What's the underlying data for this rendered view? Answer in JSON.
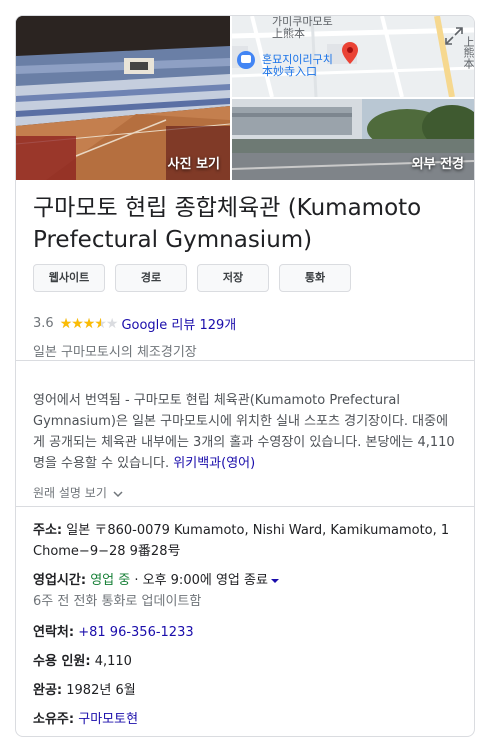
{
  "place": {
    "title": "구마모토 현립 종합체육관 (Kumamoto Prefectural Gymnasium)",
    "category": "일본 구마모토시의 체조경기장",
    "rating": {
      "score": "3.6",
      "fraction": 0.72,
      "reviews_link": "Google 리뷰 129개"
    }
  },
  "photos": {
    "interior_caption": "사진 보기",
    "street_caption": "외부 전경",
    "map_labels": {
      "station_ko": "가미쿠마모토",
      "station_ja": "上熊本",
      "temple_ko": "혼묘지이리구치",
      "temple_ja": "本妙寺入口",
      "side_label": "上熊本"
    }
  },
  "actions": [
    "웹사이트",
    "경로",
    "저장",
    "통화"
  ],
  "description": {
    "text": "영어에서 번역됨 - 구마모토 현립 체육관(Kumamoto Prefectural Gymnasium)은 일본 구마모토시에 위치한 실내 스포츠 경기장이다. 대중에게 공개되는 체육관 내부에는 3개의 홀과 수영장이 있습니다. 본당에는 4,110명을 수용할 수 있습니다.",
    "source_link": "위키백과(영어)",
    "original_toggle": "원래 설명 보기"
  },
  "details": {
    "address_label": "주소:",
    "address_value": "일본 〒860-0079 Kumamoto, Nishi Ward, Kamikumamoto, 1 Chome−9−28 9番28号",
    "hours_label": "영업시간:",
    "hours_status": "영업 중",
    "hours_sep": " · ",
    "hours_close": "오후 9:00에 영업 종료",
    "hours_updated": "6주 전 전화 통화로 업데이트함",
    "phone_label": "연락처:",
    "phone_value": "+81 96-356-1233",
    "capacity_label": "수용 인원:",
    "capacity_value": "4,110",
    "completed_label": "완공:",
    "completed_value": "1982년 6월",
    "owner_label": "소유주:",
    "owner_value": "구마모토현"
  },
  "colors": {
    "link": "#1a0dab",
    "open": "#188038",
    "star": "#fbbc04",
    "pin": "#ea4335"
  }
}
